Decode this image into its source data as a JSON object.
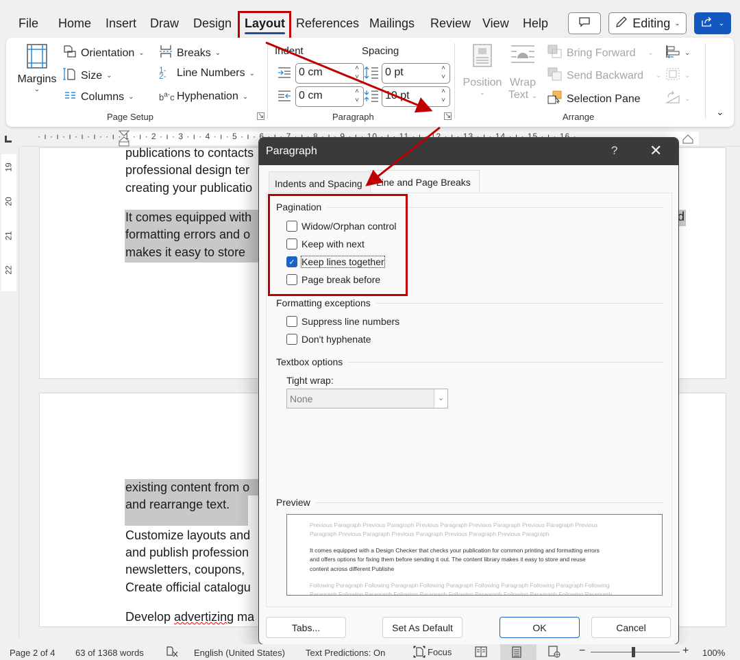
{
  "menu": {
    "tabs": [
      "File",
      "Home",
      "Insert",
      "Draw",
      "Design",
      "Layout",
      "References",
      "Mailings",
      "Review",
      "View",
      "Help"
    ],
    "active_tab": "Layout",
    "editing_label": "Editing"
  },
  "ribbon": {
    "page_setup": {
      "margins": "Margins",
      "orientation": "Orientation",
      "size": "Size",
      "columns": "Columns",
      "breaks": "Breaks",
      "line_numbers": "Line Numbers",
      "hyphenation": "Hyphenation",
      "group_label": "Page Setup"
    },
    "paragraph": {
      "indent_label": "Indent",
      "spacing_label": "Spacing",
      "indent_left": "0 cm",
      "indent_right": "0 cm",
      "spacing_before": "0 pt",
      "spacing_after": "10 pt",
      "group_label": "Paragraph"
    },
    "arrange": {
      "position": "Position",
      "wrap_text_1": "Wrap",
      "wrap_text_2": "Text",
      "bring_forward": "Bring Forward",
      "send_backward": "Send Backward",
      "selection_pane": "Selection Pane",
      "group_label": "Arrange"
    }
  },
  "ruler": {
    "horizontal": "· ı · ı · ı · ı · ı ·   · ı · 1 · ı · 2 · ı · 3 · ı · 4 · ı · 5 · ı · 6 · ı · 7 · ı · 8 · ı · 9 · ı · 10 · ı · 11 · ı · 12 · ı · 13 · ı · 14 · ı · 15 · ı · 16 ·",
    "vertical": [
      "19",
      "20",
      "21",
      "22"
    ]
  },
  "document": {
    "page1_lines": [
      "publications to contacts",
      "professional design ter",
      "creating your publicatio"
    ],
    "page1_selected": [
      "It comes equipped with",
      "formatting errors and o",
      "makes it easy to store"
    ],
    "page1_right_fragment": "d",
    "page2_selected": [
      "existing content from o",
      "and rearrange text."
    ],
    "page2_lines": [
      "Customize layouts and",
      "and publish profession",
      "newsletters, coupons,",
      "Create official catalogu"
    ],
    "page2_last_pre": "Develop ",
    "page2_last_misspelled": "advertizing",
    "page2_last_post": " ma"
  },
  "dialog": {
    "title": "Paragraph",
    "help": "?",
    "tabs": [
      "Indents and Spacing",
      "Line and Page Breaks"
    ],
    "active_tab": "Line and Page Breaks",
    "pagination": {
      "label": "Pagination",
      "options": [
        {
          "label": "Widow/Orphan control",
          "checked": false
        },
        {
          "label": "Keep with next",
          "checked": false
        },
        {
          "label": "Keep lines together",
          "checked": true
        },
        {
          "label": "Page break before",
          "checked": false
        }
      ]
    },
    "formatting_exceptions": {
      "label": "Formatting exceptions",
      "options": [
        {
          "label": "Suppress line numbers",
          "checked": false
        },
        {
          "label": "Don't hyphenate",
          "checked": false
        }
      ]
    },
    "textbox_options": {
      "label": "Textbox options",
      "tight_wrap_label": "Tight wrap:",
      "tight_wrap_value": "None"
    },
    "preview": {
      "label": "Preview",
      "previous": [
        "Previous Paragraph Previous Paragraph Previous Paragraph Previous Paragraph Previous Paragraph Previous",
        "Paragraph Previous Paragraph Previous Paragraph Previous Paragraph Previous Paragraph"
      ],
      "current": [
        "It comes equipped with a Design Checker that checks your publication for common printing and formatting errors",
        "and offers options for fixing them before sending it out. The content library makes it easy to store and reuse",
        "content across different Publishe"
      ],
      "following": [
        "Following Paragraph Following Paragraph Following Paragraph Following Paragraph Following Paragraph Following",
        "Paragraph Following Paragraph Following Paragraph Following Paragraph Following Paragraph Following Paragraph"
      ]
    },
    "buttons": {
      "tabs": "Tabs...",
      "set_default": "Set As Default",
      "ok": "OK",
      "cancel": "Cancel"
    }
  },
  "status": {
    "page": "Page 2 of 4",
    "words": "63 of 1368 words",
    "language": "English (United States)",
    "predictions": "Text Predictions: On",
    "focus": "Focus",
    "zoom": "100%",
    "zoom_minus": "−",
    "zoom_plus": "+"
  },
  "colors": {
    "annotation_red": "#c00000",
    "accent_blue": "#1557c0",
    "checkbox_blue": "#1a63c4",
    "dialog_titlebar": "#3a3a3a"
  }
}
